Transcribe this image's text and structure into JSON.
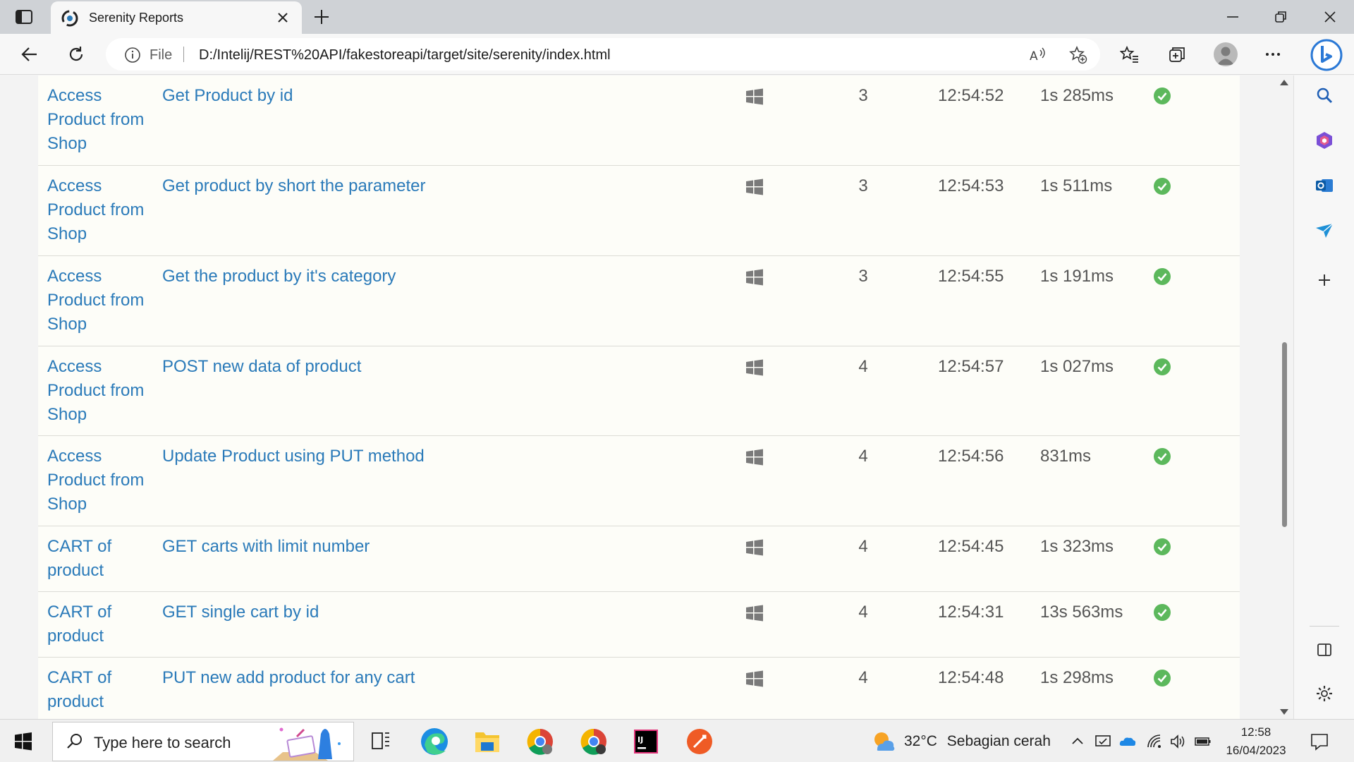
{
  "browser": {
    "tab_title": "Serenity Reports",
    "address": {
      "scheme_label": "File",
      "url": "D:/Intelij/REST%20API/fakestoreapi/target/site/serenity/index.html"
    }
  },
  "report": {
    "rows": [
      {
        "feature": "Access Product from Shop",
        "scenario": "Get Product by id",
        "os_icon": "windows-icon",
        "steps": "3",
        "start_time": "12:54:52",
        "duration": "1s 285ms",
        "result": "success"
      },
      {
        "feature": "Access Product from Shop",
        "scenario": "Get product by short the parameter",
        "os_icon": "windows-icon",
        "steps": "3",
        "start_time": "12:54:53",
        "duration": "1s 511ms",
        "result": "success"
      },
      {
        "feature": "Access Product from Shop",
        "scenario": "Get the product by it's category",
        "os_icon": "windows-icon",
        "steps": "3",
        "start_time": "12:54:55",
        "duration": "1s 191ms",
        "result": "success"
      },
      {
        "feature": "Access Product from Shop",
        "scenario": "POST new data of product",
        "os_icon": "windows-icon",
        "steps": "4",
        "start_time": "12:54:57",
        "duration": "1s 027ms",
        "result": "success"
      },
      {
        "feature": "Access Product from Shop",
        "scenario": "Update Product using PUT method",
        "os_icon": "windows-icon",
        "steps": "4",
        "start_time": "12:54:56",
        "duration": "831ms",
        "result": "success"
      },
      {
        "feature": "CART of product",
        "scenario": "GET carts with limit number",
        "os_icon": "windows-icon",
        "steps": "4",
        "start_time": "12:54:45",
        "duration": "1s 323ms",
        "result": "success"
      },
      {
        "feature": "CART of product",
        "scenario": "GET single cart by id",
        "os_icon": "windows-icon",
        "steps": "4",
        "start_time": "12:54:31",
        "duration": "13s 563ms",
        "result": "success"
      },
      {
        "feature": "CART of product",
        "scenario": "PUT new add product for any cart",
        "os_icon": "windows-icon",
        "steps": "4",
        "start_time": "12:54:48",
        "duration": "1s 298ms",
        "result": "success"
      }
    ]
  },
  "taskbar": {
    "search_placeholder": "Type here to search",
    "weather": {
      "temperature": "32°C",
      "condition": "Sebagian cerah"
    },
    "clock": {
      "time": "12:58",
      "date": "16/04/2023"
    }
  },
  "colors": {
    "link": "#2a7ab9",
    "success": "#5cb85c",
    "tab_strip": "#cfd2d6"
  }
}
